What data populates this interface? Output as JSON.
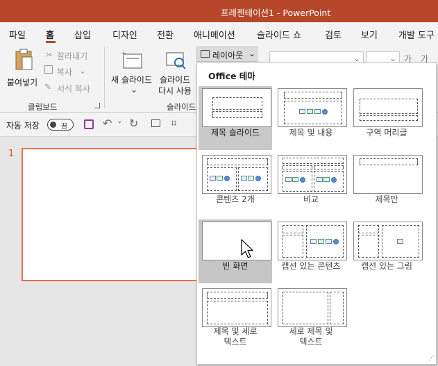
{
  "window": {
    "title": "프레젠테이션1  -  PowerPoint"
  },
  "tabs": [
    "파일",
    "홈",
    "삽입",
    "디자인",
    "전환",
    "애니메이션",
    "슬라이드 쇼",
    "검토",
    "보기",
    "개발 도구"
  ],
  "ribbon": {
    "clipboard": {
      "paste": "붙여넣기",
      "cut": "잘라내기",
      "copy": "복사",
      "format_painter": "서식 복사",
      "group": "클립보드"
    },
    "slides": {
      "new_slide": "새 슬라이드",
      "reuse_line1": "슬라이드",
      "reuse_line2": "다시 사용",
      "group": "슬라이드"
    },
    "layout_button": "레이아웃",
    "font_size_hint": "가"
  },
  "qat": {
    "autosave": "자동 저장",
    "autosave_state": "끔"
  },
  "thumbnail": {
    "number": "1"
  },
  "gallery": {
    "header": "Office 테마",
    "layouts": [
      {
        "label": "제목 슬라이드"
      },
      {
        "label": "제목 및 내용"
      },
      {
        "label": "구역 머리글"
      },
      {
        "label": "콘텐츠 2개"
      },
      {
        "label": "비교"
      },
      {
        "label": "제목만"
      },
      {
        "label": "빈 화면"
      },
      {
        "label": "캡션 있는 콘텐츠"
      },
      {
        "label": "캡션 있는 그림"
      },
      {
        "label_line1": "제목 및 세로",
        "label_line2": "텍스트"
      },
      {
        "label_line1": "세로 제목 및",
        "label_line2": "텍스트"
      }
    ]
  },
  "colors": {
    "accent": "#b7472a",
    "selection": "#c9c9c9"
  }
}
